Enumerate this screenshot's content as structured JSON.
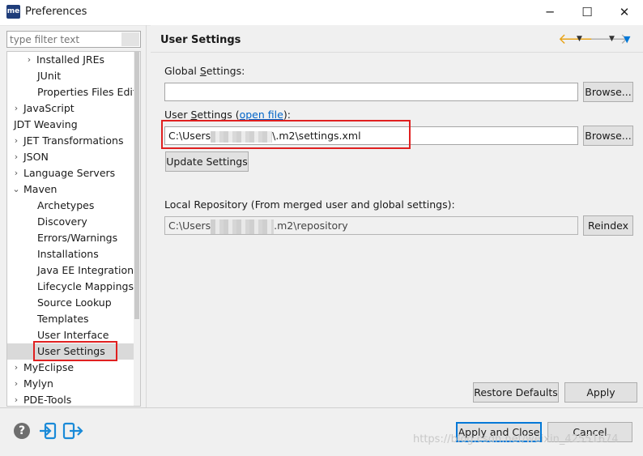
{
  "window": {
    "app_icon_text": "me",
    "title": "Preferences",
    "minimize_glyph": "─",
    "maximize_glyph": "☐",
    "close_glyph": "✕"
  },
  "filter": {
    "placeholder": "type filter text"
  },
  "tree": {
    "items": [
      {
        "label": "Installed JREs",
        "expand": "›"
      },
      {
        "label": "JUnit",
        "expand": ""
      },
      {
        "label": "Properties Files Edito",
        "expand": ""
      },
      {
        "label": "JavaScript",
        "expand": "›"
      },
      {
        "label": "JDT Weaving",
        "expand": ""
      },
      {
        "label": "JET Transformations",
        "expand": "›"
      },
      {
        "label": "JSON",
        "expand": "›"
      },
      {
        "label": "Language Servers",
        "expand": "›"
      },
      {
        "label": "Maven",
        "expand": "⌄"
      },
      {
        "label": "Archetypes",
        "expand": ""
      },
      {
        "label": "Discovery",
        "expand": ""
      },
      {
        "label": "Errors/Warnings",
        "expand": ""
      },
      {
        "label": "Installations",
        "expand": ""
      },
      {
        "label": "Java EE Integration",
        "expand": ""
      },
      {
        "label": "Lifecycle Mappings",
        "expand": ""
      },
      {
        "label": "Source Lookup",
        "expand": ""
      },
      {
        "label": "Templates",
        "expand": ""
      },
      {
        "label": "User Interface",
        "expand": ""
      },
      {
        "label": "User Settings",
        "expand": ""
      },
      {
        "label": "MyEclipse",
        "expand": "›"
      },
      {
        "label": "Mylyn",
        "expand": "›"
      },
      {
        "label": "PDE-Tools",
        "expand": "›"
      }
    ],
    "selected": "User Settings"
  },
  "page": {
    "title": "User Settings",
    "global_settings": {
      "label_prefix": "Global ",
      "label_mnemonic": "S",
      "label_suffix": "ettings:",
      "value": "",
      "browse_label": "Browse..."
    },
    "user_settings": {
      "label_prefix": "User ",
      "label_mnemonic": "S",
      "label_suffix": "ettings (",
      "open_file_link": "open file",
      "label_end": "):",
      "value_start": "C:\\Users",
      "value_end": "\\.m2\\settings.xml",
      "browse_label": "Browse...",
      "update_button": "Update Settings"
    },
    "local_repository": {
      "label": "Local Repository (From merged user and global settings):",
      "value_start": "C:\\Users",
      "value_end": ".m2\\repository",
      "reindex_label": "Reindex"
    },
    "restore_defaults_label": "Restore Defaults",
    "apply_label": "Apply"
  },
  "footer": {
    "apply_close_label": "Apply and Close",
    "cancel_label": "Cancel"
  },
  "watermark": "https://blog.csdn.net/weixin_42551674",
  "colors": {
    "accent": "#0078d7",
    "highlight_red": "#e02020",
    "nav_arrow": "#e8a317"
  }
}
